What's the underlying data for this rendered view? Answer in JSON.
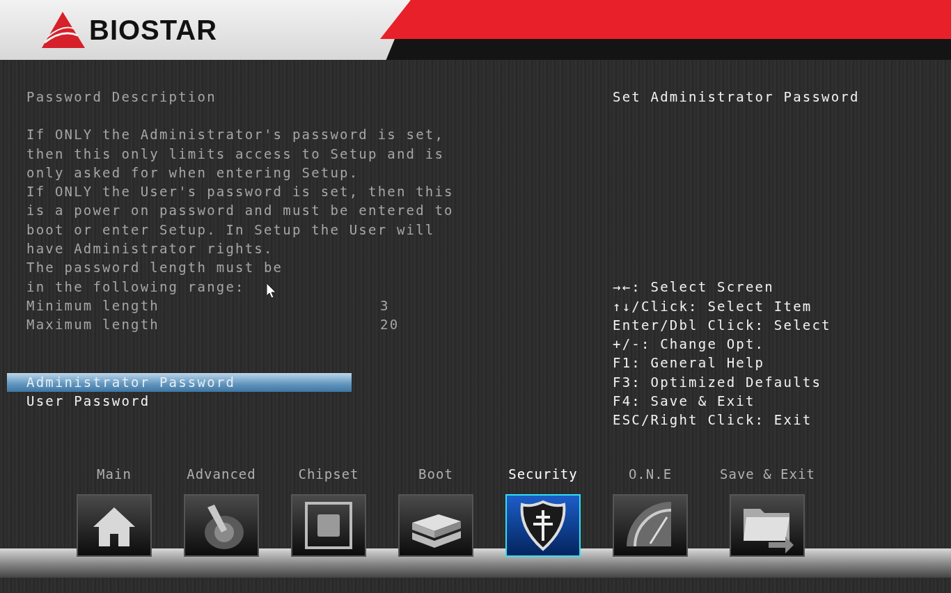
{
  "header": {
    "logo": "BIOSTAR"
  },
  "description": {
    "title": "Password Description",
    "lines": [
      "If ONLY the Administrator's password is set,",
      "then this only limits access to Setup and is",
      "only asked for when entering Setup.",
      "If ONLY the User's password is set, then this",
      "is a power on password and must be entered to",
      "boot or enter Setup. In Setup the User will",
      "have Administrator rights.",
      "The password length must be",
      "in the following range:"
    ]
  },
  "lengths": [
    {
      "name": "Minimum length",
      "value": "3"
    },
    {
      "name": "Maximum length",
      "value": "20"
    }
  ],
  "menu": [
    {
      "label": "Administrator Password",
      "selected": true
    },
    {
      "label": "User Password",
      "selected": false
    }
  ],
  "help": {
    "title": "Set Administrator Password",
    "keys": [
      "→←: Select Screen",
      "↑↓/Click: Select Item",
      "Enter/Dbl Click: Select",
      "+/-: Change Opt.",
      "F1: General Help",
      "F3: Optimized Defaults",
      "F4: Save & Exit",
      "ESC/Right Click: Exit"
    ]
  },
  "tabs": [
    {
      "label": "Main",
      "kind": "home",
      "selected": false
    },
    {
      "label": "Advanced",
      "kind": "joystick",
      "selected": false
    },
    {
      "label": "Chipset",
      "kind": "chip",
      "selected": false
    },
    {
      "label": "Boot",
      "kind": "drives",
      "selected": false
    },
    {
      "label": "Security",
      "kind": "shield",
      "selected": true
    },
    {
      "label": "O.N.E",
      "kind": "gauge",
      "selected": false
    },
    {
      "label": "Save & Exit",
      "kind": "folder",
      "selected": false
    }
  ]
}
